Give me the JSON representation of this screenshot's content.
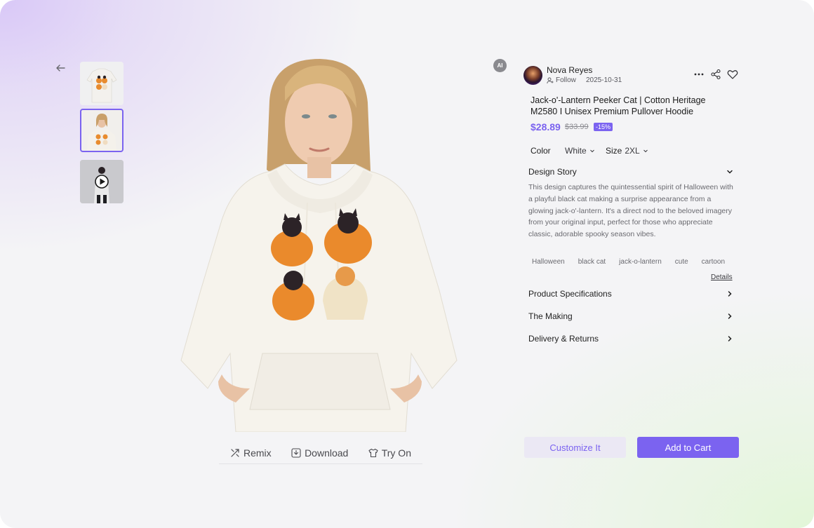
{
  "colors": {
    "accent": "#7b63f0",
    "accent_soft": "#ebe8f4",
    "text_muted": "#6a6a70"
  },
  "nav": {
    "back_icon": "arrow-left-icon"
  },
  "ai_badge": "AI",
  "author": {
    "name": "Nova Reyes",
    "follow_label": "Follow",
    "date": "2025-10-31"
  },
  "header_icons": [
    "more-icon",
    "share-icon",
    "heart-icon"
  ],
  "product": {
    "title": "Jack-o'-Lantern Peeker Cat | Cotton Heritage M2580 I Unisex Premium Pullover Hoodie",
    "price": "$28.89",
    "old_price": "$33.99",
    "discount": "-15%"
  },
  "options": {
    "color_label": "Color",
    "color_value": "White",
    "size_label": "Size",
    "size_value": "2XL"
  },
  "design_story": {
    "title": "Design Story",
    "text": "This design captures the quintessential spirit of Halloween with a playful black cat making a surprise appearance from a glowing jack-o'-lantern. It's a direct nod to the beloved imagery from your original input, perfect for those who appreciate classic, adorable spooky season vibes.",
    "tags": [
      "Halloween",
      "black cat",
      "jack-o-lantern",
      "cute",
      "cartoon"
    ],
    "details_label": "Details"
  },
  "sections": [
    "Product Specifications",
    "The Making",
    "Delivery & Returns"
  ],
  "image_actions": {
    "remix": "Remix",
    "download": "Download",
    "try_on": "Try On"
  },
  "buttons": {
    "customize": "Customize It",
    "add_to_cart": "Add to Cart"
  }
}
